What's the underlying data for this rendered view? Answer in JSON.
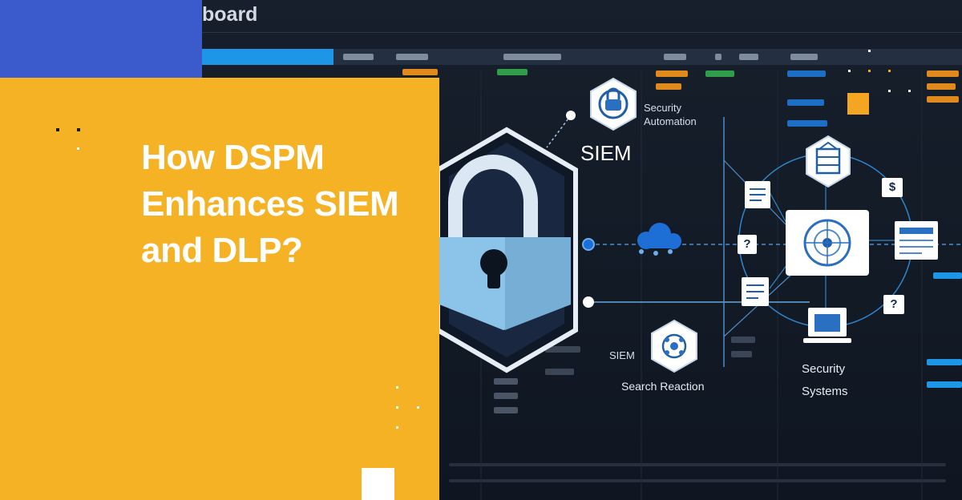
{
  "dashboard": {
    "title": "board"
  },
  "hero": {
    "headline": "How DSPM Enhances SIEM and DLP?"
  },
  "diagram": {
    "labels": {
      "siem_main": "SIEM",
      "security_automation": "Security Automation",
      "siem_small": "SIEM",
      "search_reaction": "Search Reaction",
      "security_systems": "Security Systems"
    },
    "badges": {
      "question_left": "?",
      "dollar": "$",
      "question_right": "?"
    }
  },
  "colors": {
    "accent_yellow": "#f4b224",
    "accent_blue": "#3b5bcc",
    "dashboard_blue": "#1d96e8",
    "lock_body": "#8cc3e8",
    "background": "#121a26"
  }
}
